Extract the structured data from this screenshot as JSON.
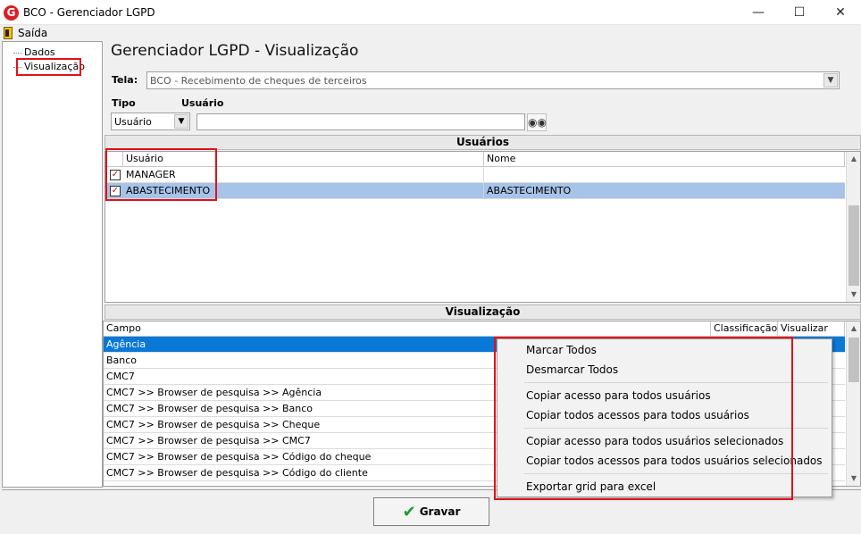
{
  "window": {
    "title": "BCO - Gerenciador LGPD",
    "logo_letter": "G"
  },
  "menu": {
    "exit_label": "Saída"
  },
  "tree": {
    "items": [
      "Dados",
      "Visualização"
    ]
  },
  "page": {
    "title": "Gerenciador LGPD - Visualização"
  },
  "filters": {
    "tela_label": "Tela:",
    "tela_value": "BCO - Recebimento de cheques de terceiros",
    "tipo_label": "Tipo",
    "tipo_value": "Usuário",
    "usuario_label": "Usuário",
    "usuario_value": ""
  },
  "users_section": {
    "title": "Usuários",
    "columns": [
      "Usuário",
      "Nome"
    ],
    "rows": [
      {
        "usuario": "MANAGER",
        "nome": "",
        "checked": true
      },
      {
        "usuario": "ABASTECIMENTO",
        "nome": "ABASTECIMENTO",
        "checked": true
      }
    ]
  },
  "visualization_section": {
    "title": "Visualização",
    "columns": [
      "Campo",
      "Classificação",
      "Visualizar"
    ],
    "rows": [
      "Agência",
      "Banco",
      "CMC7",
      "CMC7 >> Browser de pesquisa >> Agência",
      "CMC7 >> Browser de pesquisa >> Banco",
      "CMC7 >> Browser de pesquisa >> Cheque",
      "CMC7 >> Browser de pesquisa >> CMC7",
      "CMC7 >> Browser de pesquisa >> Código do cheque",
      "CMC7 >> Browser de pesquisa >> Código do cliente"
    ]
  },
  "context_menu": {
    "items": [
      "Marcar Todos",
      "Desmarcar Todos",
      "Copiar acesso para todos usuários",
      "Copiar todos acessos para todos usuários",
      "Copiar acesso para todos usuários selecionados",
      "Copiar todos acessos para todos usuários selecionados",
      "Exportar grid para excel"
    ]
  },
  "footer": {
    "save_label": "Gravar"
  },
  "colors": {
    "highlight_box": "#e0111b",
    "selected_row": "#0a78d7",
    "checked_user_row": "#a7c3e8"
  }
}
